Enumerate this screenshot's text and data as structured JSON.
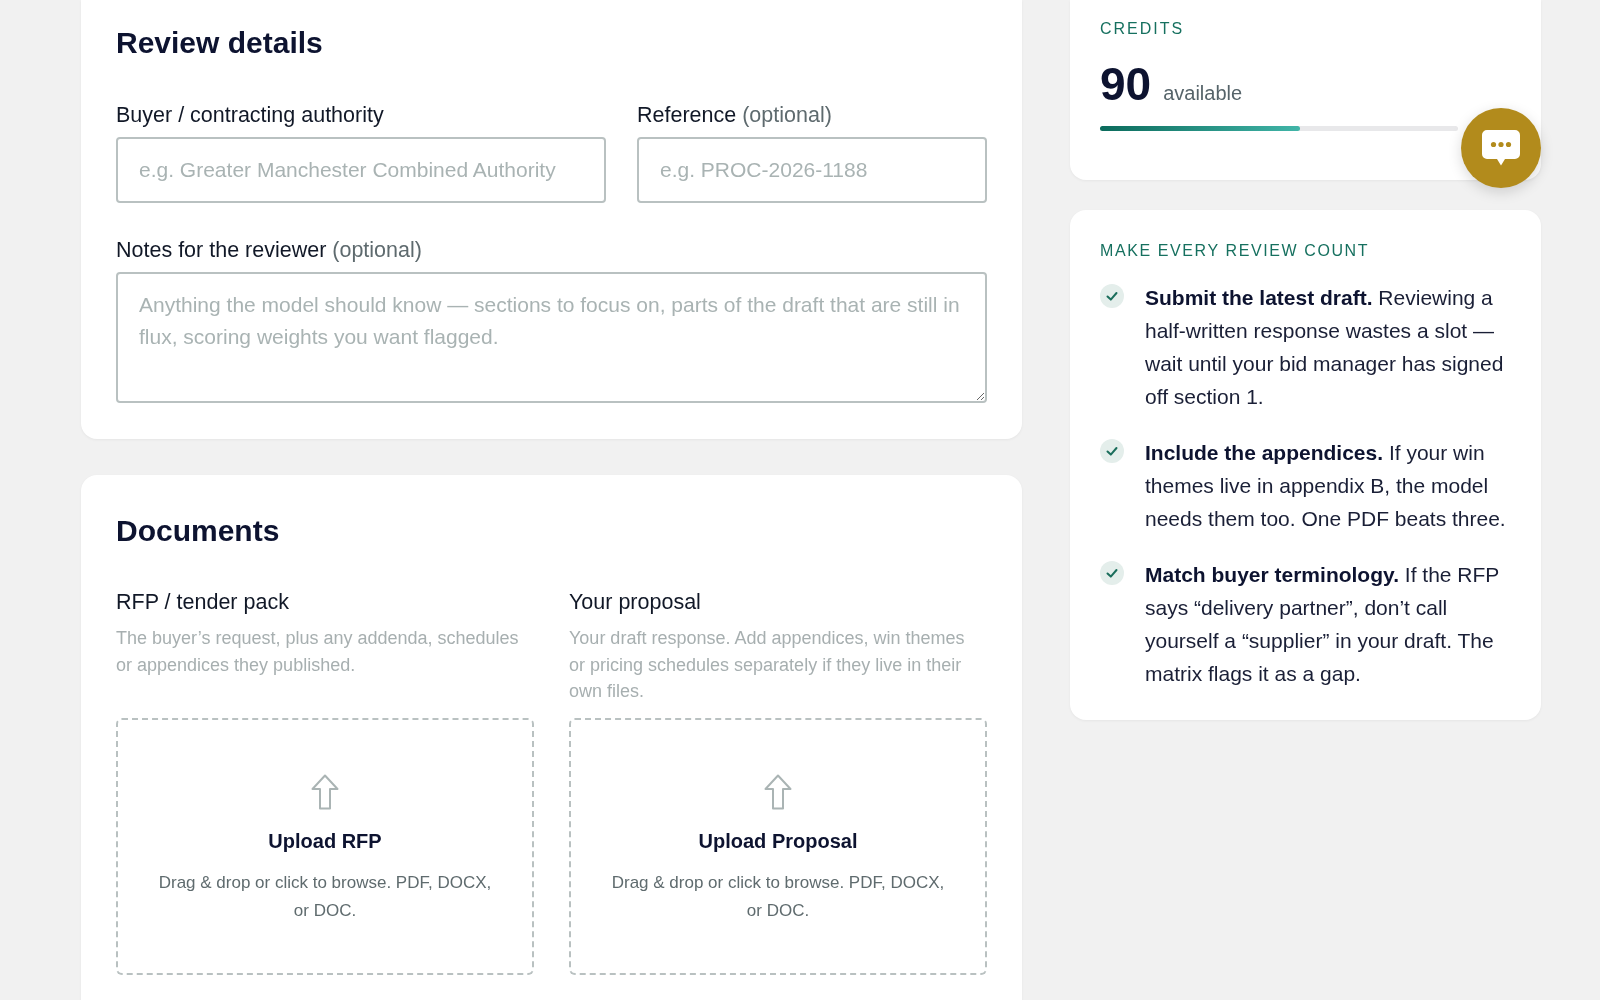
{
  "review_details": {
    "title": "Review details",
    "fields": [
      {
        "kind": "input",
        "label": "Buyer / contracting authority",
        "placeholder": "e.g. Greater Manchester Combined Authority"
      },
      {
        "kind": "input",
        "label": "Reference",
        "note": "(optional)",
        "placeholder": "e.g. PROC-2026-1188"
      },
      {
        "kind": "textarea",
        "label": "Notes for the reviewer",
        "note": "(optional)",
        "placeholder": "Anything the model should know — sections to focus on, parts of the draft that are still in flux, scoring weights you want flagged."
      }
    ]
  },
  "documents": {
    "title": "Documents",
    "uploads": [
      {
        "label": "RFP / tender pack",
        "description": "The buyer’s request, plus any addenda, schedules or appendices they published.",
        "title": "Upload RFP",
        "hint": "Drag & drop or click to browse. PDF, DOCX, or DOC."
      },
      {
        "label": "Your proposal",
        "description": "Your draft response. Add appendices, win themes or pricing schedules separately if they live in their own files.",
        "title": "Upload Proposal",
        "hint": "Drag & drop or click to browse. PDF, DOCX, or DOC."
      }
    ]
  },
  "credits": {
    "title": "CREDITS",
    "amount": "90",
    "unit": "available",
    "level": 0.56
  },
  "tips": {
    "title": "MAKE EVERY REVIEW COUNT",
    "items": [
      {
        "text": "**Submit the latest draft.** Reviewing a half-written response wastes a slot — wait until your bid manager has signed off section 1."
      },
      {
        "text": "**Include the appendices.** If your win themes live in appendix B, the model needs them too. One PDF beats three."
      },
      {
        "text": "**Match buyer terminology.** If the RFP says “delivery partner”, don’t call yourself a “supplier” in your draft. The matrix flags it as a gap."
      }
    ]
  }
}
